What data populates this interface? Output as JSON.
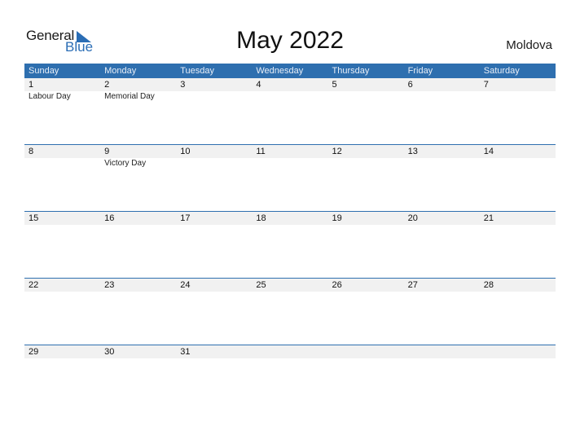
{
  "logo": {
    "general": "General",
    "blue": "Blue"
  },
  "title": "May 2022",
  "country": "Moldova",
  "colors": {
    "header": "#2e6faf",
    "daybar": "#f1f1f1",
    "logo_blue": "#2a6db5"
  },
  "weekdays": [
    "Sunday",
    "Monday",
    "Tuesday",
    "Wednesday",
    "Thursday",
    "Friday",
    "Saturday"
  ],
  "weeks": [
    {
      "days": [
        "1",
        "2",
        "3",
        "4",
        "5",
        "6",
        "7"
      ],
      "events": [
        "Labour Day",
        "Memorial Day",
        "",
        "",
        "",
        "",
        ""
      ]
    },
    {
      "days": [
        "8",
        "9",
        "10",
        "11",
        "12",
        "13",
        "14"
      ],
      "events": [
        "",
        "Victory Day",
        "",
        "",
        "",
        "",
        ""
      ]
    },
    {
      "days": [
        "15",
        "16",
        "17",
        "18",
        "19",
        "20",
        "21"
      ],
      "events": [
        "",
        "",
        "",
        "",
        "",
        "",
        ""
      ]
    },
    {
      "days": [
        "22",
        "23",
        "24",
        "25",
        "26",
        "27",
        "28"
      ],
      "events": [
        "",
        "",
        "",
        "",
        "",
        "",
        ""
      ]
    },
    {
      "days": [
        "29",
        "30",
        "31",
        "",
        "",
        "",
        ""
      ],
      "events": [
        "",
        "",
        "",
        "",
        "",
        "",
        ""
      ]
    }
  ]
}
